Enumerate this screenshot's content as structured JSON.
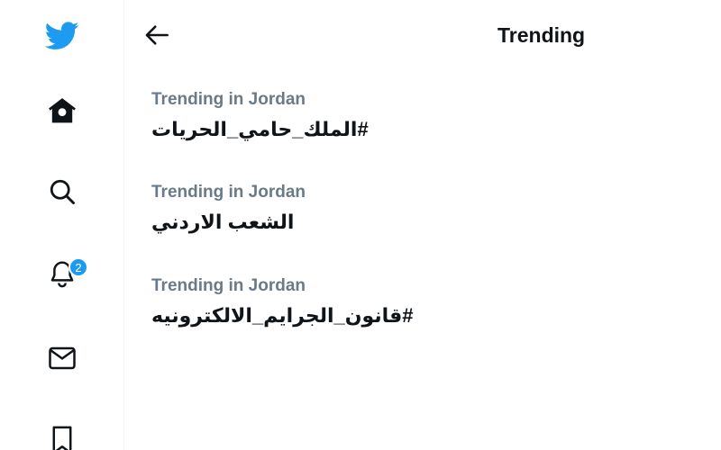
{
  "header": {
    "title": "Trending"
  },
  "sidebar": {
    "items": [
      {
        "name": "twitter-logo-icon"
      },
      {
        "name": "home-icon"
      },
      {
        "name": "search-icon"
      },
      {
        "name": "notifications-icon",
        "badge": "2"
      },
      {
        "name": "messages-icon"
      },
      {
        "name": "bookmarks-icon"
      }
    ]
  },
  "trends": [
    {
      "context": "Trending in Jordan",
      "name": "#الملك_حامي_الحريات"
    },
    {
      "context": "Trending in Jordan",
      "name": "الشعب الاردني"
    },
    {
      "context": "Trending in Jordan",
      "name": "#قانون_الجرايم_الالكترونيه"
    }
  ],
  "colors": {
    "brand": "#1d9bf0",
    "text_primary": "#0f1419",
    "text_secondary": "#6a7a88",
    "divider": "#eff3f4"
  }
}
